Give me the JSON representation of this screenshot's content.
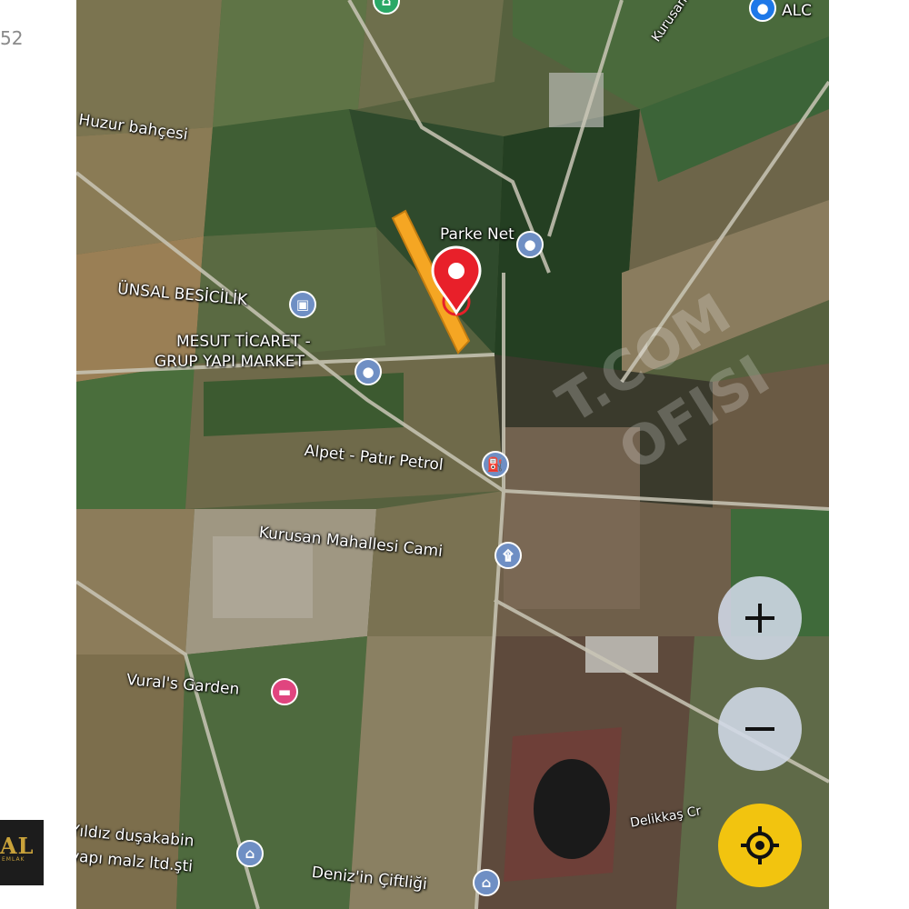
{
  "corner_text": "52",
  "logo": {
    "main": "AL",
    "sub": "EMLAK"
  },
  "watermark": {
    "line1": "T.COM",
    "line2": "OFISI"
  },
  "map": {
    "labels": {
      "alc_partial": "ALC",
      "kurusan_yolu": "Kurusan Yolu",
      "huzur_bahcesi": "Huzur bahçesi",
      "parke_net": "Parke Net",
      "unsal_besicilik": "ÜNSAL BESİCİLİK",
      "mesut_ticaret_line1": "MESUT TİCARET -",
      "mesut_ticaret_line2": "GRUP YAPI MARKET",
      "alpet": "Alpet - Patır Petrol",
      "kurusan_cami": "Kurusan Mahallesi Cami",
      "vurals_garden": "Vural's Garden",
      "yildiz_line1": "Yıldız duşakabin",
      "yildiz_line2": "yapı malz ltd.şti",
      "deniz_ciftligi": "Deniz'in Çiftliği",
      "delikkas_partial": "Delikkaş Cr"
    },
    "icons": {
      "parke_net": "map-pin-icon",
      "unsal": "business-icon",
      "mesut": "map-pin-icon",
      "alpet": "gas-station-icon",
      "cami": "mosque-icon",
      "vurals": "hotel-icon",
      "yildiz": "shopping-bag-icon",
      "deniz": "shopping-bag-icon",
      "alc": "map-pin-icon",
      "top_pin": "map-pin-icon"
    },
    "controls": {
      "zoom_in_label": "+",
      "zoom_out_label": "−"
    },
    "colors": {
      "parcel_highlight": "#f5a623",
      "marker_red": "#e8202a",
      "locate_yellow": "#f2c40f",
      "poi_blue": "#6f8fc4",
      "poi_pink": "#e0457f"
    }
  }
}
